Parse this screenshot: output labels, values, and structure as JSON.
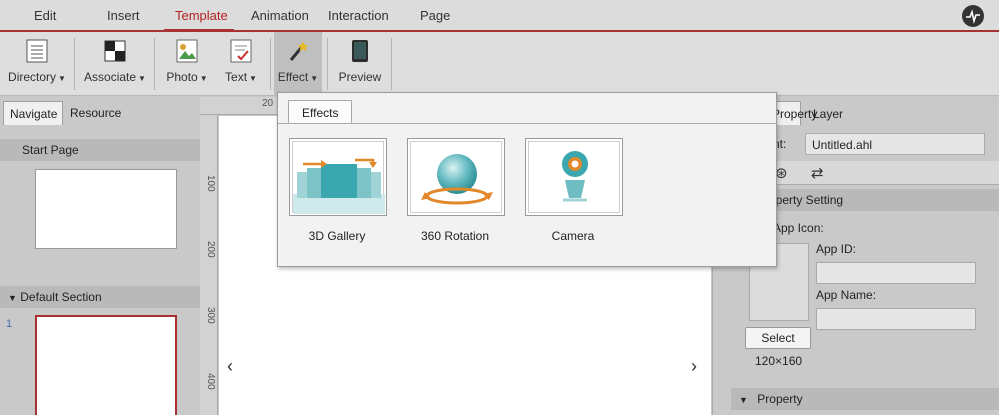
{
  "menu": {
    "tabs": [
      "Edit",
      "Insert",
      "Template",
      "Animation",
      "Interaction",
      "Page"
    ],
    "active": "Template"
  },
  "toolbar": {
    "items": [
      "Directory",
      "Associate",
      "Photo",
      "Text",
      "Effect",
      "Preview"
    ]
  },
  "left_panel": {
    "tabs": [
      "Navigate",
      "Resource"
    ],
    "start_page": "Start Page",
    "default_section": "Default Section",
    "page_number": "1"
  },
  "ruler": {
    "top_label": "20",
    "left_labels": [
      "100",
      "200",
      "300",
      "400"
    ]
  },
  "effects_popup": {
    "tab": "Effects",
    "items": [
      "3D Gallery",
      "360 Rotation",
      "Camera"
    ]
  },
  "right_panel": {
    "tabs": [
      "Property",
      "Layer"
    ],
    "current_label": "Current:",
    "current_value": "Untitled.ahl",
    "property_setting": "Property Setting",
    "app_icon_label": "App Icon:",
    "app_id_label": "App ID:",
    "app_name_label": "App Name:",
    "select_button": "Select",
    "icon_size": "120×160",
    "property_section": "Property"
  },
  "colors": {
    "accent": "#a83232",
    "teal": "#3aa6ad",
    "orange": "#e0882a"
  }
}
